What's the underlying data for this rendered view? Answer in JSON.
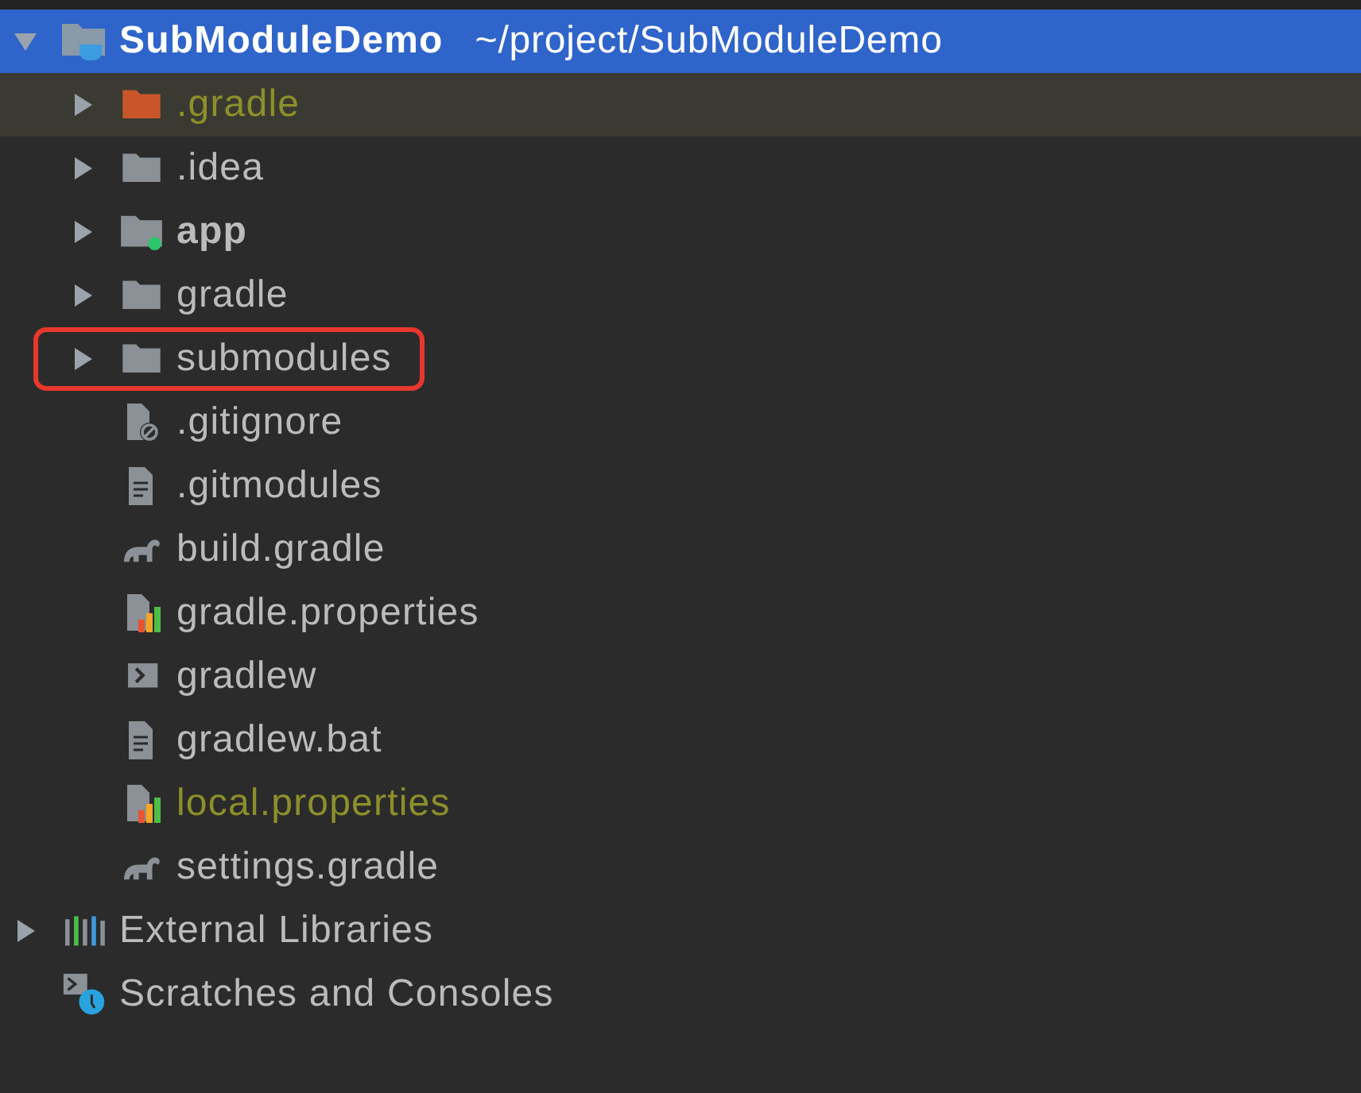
{
  "tree": [
    {
      "kind": "project",
      "name": "SubModuleDemo",
      "path": "~/project/SubModuleDemo",
      "expanded": true,
      "selected": true,
      "children": [
        {
          "kind": "folder-excluded",
          "name": ".gradle",
          "expanded": false,
          "ignored": true,
          "highlighted": true,
          "annotated": false
        },
        {
          "kind": "folder",
          "name": ".idea",
          "expanded": false,
          "ignored": false,
          "highlighted": false,
          "annotated": false
        },
        {
          "kind": "module",
          "name": "app",
          "expanded": false,
          "ignored": false,
          "highlighted": false,
          "annotated": false
        },
        {
          "kind": "folder",
          "name": "gradle",
          "expanded": false,
          "ignored": false,
          "highlighted": false,
          "annotated": false
        },
        {
          "kind": "folder",
          "name": "submodules",
          "expanded": false,
          "ignored": false,
          "highlighted": false,
          "annotated": true
        },
        {
          "kind": "file-ignore",
          "name": ".gitignore",
          "ignored": false,
          "highlighted": false,
          "annotated": false
        },
        {
          "kind": "file-text",
          "name": ".gitmodules",
          "ignored": false,
          "highlighted": false,
          "annotated": false
        },
        {
          "kind": "gradle",
          "name": "build.gradle",
          "ignored": false,
          "highlighted": false,
          "annotated": false
        },
        {
          "kind": "properties",
          "name": "gradle.properties",
          "ignored": false,
          "highlighted": false,
          "annotated": false
        },
        {
          "kind": "script",
          "name": "gradlew",
          "ignored": false,
          "highlighted": false,
          "annotated": false
        },
        {
          "kind": "file-text",
          "name": "gradlew.bat",
          "ignored": false,
          "highlighted": false,
          "annotated": false
        },
        {
          "kind": "properties",
          "name": "local.properties",
          "ignored": true,
          "highlighted": false,
          "annotated": false
        },
        {
          "kind": "gradle",
          "name": "settings.gradle",
          "ignored": false,
          "highlighted": false,
          "annotated": false
        }
      ]
    },
    {
      "kind": "libraries",
      "name": "External Libraries",
      "expanded": false,
      "selected": false
    },
    {
      "kind": "scratches",
      "name": "Scratches and Consoles",
      "selected": false
    }
  ]
}
